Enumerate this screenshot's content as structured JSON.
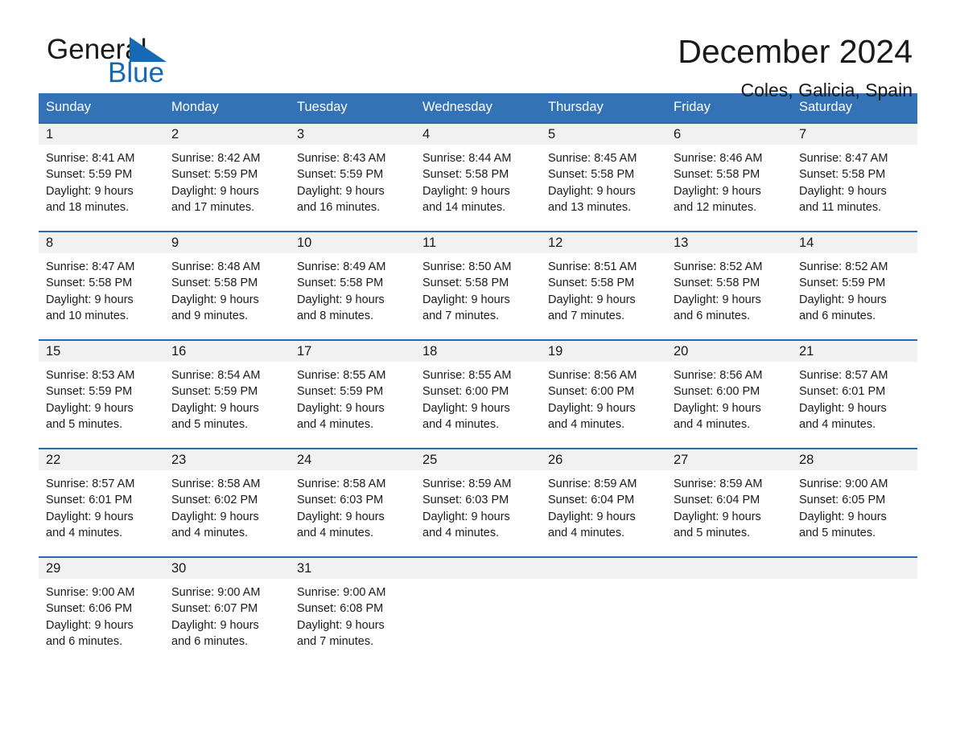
{
  "brand": {
    "name_part1": "General",
    "name_part2": "Blue",
    "accent_color": "#1669b2",
    "logo_icon": "triangle-flag-icon"
  },
  "header": {
    "title": "December 2024",
    "location": "Coles, Galicia, Spain"
  },
  "calendar": {
    "header_bg": "#3272b5",
    "row_divider_color": "#2a6ab0",
    "day_band_bg": "#f1f1f1",
    "weekday_headers": [
      "Sunday",
      "Monday",
      "Tuesday",
      "Wednesday",
      "Thursday",
      "Friday",
      "Saturday"
    ],
    "weeks": [
      [
        {
          "day": "1",
          "sunrise": "Sunrise: 8:41 AM",
          "sunset": "Sunset: 5:59 PM",
          "daylight_1": "Daylight: 9 hours",
          "daylight_2": "and 18 minutes."
        },
        {
          "day": "2",
          "sunrise": "Sunrise: 8:42 AM",
          "sunset": "Sunset: 5:59 PM",
          "daylight_1": "Daylight: 9 hours",
          "daylight_2": "and 17 minutes."
        },
        {
          "day": "3",
          "sunrise": "Sunrise: 8:43 AM",
          "sunset": "Sunset: 5:59 PM",
          "daylight_1": "Daylight: 9 hours",
          "daylight_2": "and 16 minutes."
        },
        {
          "day": "4",
          "sunrise": "Sunrise: 8:44 AM",
          "sunset": "Sunset: 5:58 PM",
          "daylight_1": "Daylight: 9 hours",
          "daylight_2": "and 14 minutes."
        },
        {
          "day": "5",
          "sunrise": "Sunrise: 8:45 AM",
          "sunset": "Sunset: 5:58 PM",
          "daylight_1": "Daylight: 9 hours",
          "daylight_2": "and 13 minutes."
        },
        {
          "day": "6",
          "sunrise": "Sunrise: 8:46 AM",
          "sunset": "Sunset: 5:58 PM",
          "daylight_1": "Daylight: 9 hours",
          "daylight_2": "and 12 minutes."
        },
        {
          "day": "7",
          "sunrise": "Sunrise: 8:47 AM",
          "sunset": "Sunset: 5:58 PM",
          "daylight_1": "Daylight: 9 hours",
          "daylight_2": "and 11 minutes."
        }
      ],
      [
        {
          "day": "8",
          "sunrise": "Sunrise: 8:47 AM",
          "sunset": "Sunset: 5:58 PM",
          "daylight_1": "Daylight: 9 hours",
          "daylight_2": "and 10 minutes."
        },
        {
          "day": "9",
          "sunrise": "Sunrise: 8:48 AM",
          "sunset": "Sunset: 5:58 PM",
          "daylight_1": "Daylight: 9 hours",
          "daylight_2": "and 9 minutes."
        },
        {
          "day": "10",
          "sunrise": "Sunrise: 8:49 AM",
          "sunset": "Sunset: 5:58 PM",
          "daylight_1": "Daylight: 9 hours",
          "daylight_2": "and 8 minutes."
        },
        {
          "day": "11",
          "sunrise": "Sunrise: 8:50 AM",
          "sunset": "Sunset: 5:58 PM",
          "daylight_1": "Daylight: 9 hours",
          "daylight_2": "and 7 minutes."
        },
        {
          "day": "12",
          "sunrise": "Sunrise: 8:51 AM",
          "sunset": "Sunset: 5:58 PM",
          "daylight_1": "Daylight: 9 hours",
          "daylight_2": "and 7 minutes."
        },
        {
          "day": "13",
          "sunrise": "Sunrise: 8:52 AM",
          "sunset": "Sunset: 5:58 PM",
          "daylight_1": "Daylight: 9 hours",
          "daylight_2": "and 6 minutes."
        },
        {
          "day": "14",
          "sunrise": "Sunrise: 8:52 AM",
          "sunset": "Sunset: 5:59 PM",
          "daylight_1": "Daylight: 9 hours",
          "daylight_2": "and 6 minutes."
        }
      ],
      [
        {
          "day": "15",
          "sunrise": "Sunrise: 8:53 AM",
          "sunset": "Sunset: 5:59 PM",
          "daylight_1": "Daylight: 9 hours",
          "daylight_2": "and 5 minutes."
        },
        {
          "day": "16",
          "sunrise": "Sunrise: 8:54 AM",
          "sunset": "Sunset: 5:59 PM",
          "daylight_1": "Daylight: 9 hours",
          "daylight_2": "and 5 minutes."
        },
        {
          "day": "17",
          "sunrise": "Sunrise: 8:55 AM",
          "sunset": "Sunset: 5:59 PM",
          "daylight_1": "Daylight: 9 hours",
          "daylight_2": "and 4 minutes."
        },
        {
          "day": "18",
          "sunrise": "Sunrise: 8:55 AM",
          "sunset": "Sunset: 6:00 PM",
          "daylight_1": "Daylight: 9 hours",
          "daylight_2": "and 4 minutes."
        },
        {
          "day": "19",
          "sunrise": "Sunrise: 8:56 AM",
          "sunset": "Sunset: 6:00 PM",
          "daylight_1": "Daylight: 9 hours",
          "daylight_2": "and 4 minutes."
        },
        {
          "day": "20",
          "sunrise": "Sunrise: 8:56 AM",
          "sunset": "Sunset: 6:00 PM",
          "daylight_1": "Daylight: 9 hours",
          "daylight_2": "and 4 minutes."
        },
        {
          "day": "21",
          "sunrise": "Sunrise: 8:57 AM",
          "sunset": "Sunset: 6:01 PM",
          "daylight_1": "Daylight: 9 hours",
          "daylight_2": "and 4 minutes."
        }
      ],
      [
        {
          "day": "22",
          "sunrise": "Sunrise: 8:57 AM",
          "sunset": "Sunset: 6:01 PM",
          "daylight_1": "Daylight: 9 hours",
          "daylight_2": "and 4 minutes."
        },
        {
          "day": "23",
          "sunrise": "Sunrise: 8:58 AM",
          "sunset": "Sunset: 6:02 PM",
          "daylight_1": "Daylight: 9 hours",
          "daylight_2": "and 4 minutes."
        },
        {
          "day": "24",
          "sunrise": "Sunrise: 8:58 AM",
          "sunset": "Sunset: 6:03 PM",
          "daylight_1": "Daylight: 9 hours",
          "daylight_2": "and 4 minutes."
        },
        {
          "day": "25",
          "sunrise": "Sunrise: 8:59 AM",
          "sunset": "Sunset: 6:03 PM",
          "daylight_1": "Daylight: 9 hours",
          "daylight_2": "and 4 minutes."
        },
        {
          "day": "26",
          "sunrise": "Sunrise: 8:59 AM",
          "sunset": "Sunset: 6:04 PM",
          "daylight_1": "Daylight: 9 hours",
          "daylight_2": "and 4 minutes."
        },
        {
          "day": "27",
          "sunrise": "Sunrise: 8:59 AM",
          "sunset": "Sunset: 6:04 PM",
          "daylight_1": "Daylight: 9 hours",
          "daylight_2": "and 5 minutes."
        },
        {
          "day": "28",
          "sunrise": "Sunrise: 9:00 AM",
          "sunset": "Sunset: 6:05 PM",
          "daylight_1": "Daylight: 9 hours",
          "daylight_2": "and 5 minutes."
        }
      ],
      [
        {
          "day": "29",
          "sunrise": "Sunrise: 9:00 AM",
          "sunset": "Sunset: 6:06 PM",
          "daylight_1": "Daylight: 9 hours",
          "daylight_2": "and 6 minutes."
        },
        {
          "day": "30",
          "sunrise": "Sunrise: 9:00 AM",
          "sunset": "Sunset: 6:07 PM",
          "daylight_1": "Daylight: 9 hours",
          "daylight_2": "and 6 minutes."
        },
        {
          "day": "31",
          "sunrise": "Sunrise: 9:00 AM",
          "sunset": "Sunset: 6:08 PM",
          "daylight_1": "Daylight: 9 hours",
          "daylight_2": "and 7 minutes."
        },
        {
          "day": "",
          "sunrise": "",
          "sunset": "",
          "daylight_1": "",
          "daylight_2": ""
        },
        {
          "day": "",
          "sunrise": "",
          "sunset": "",
          "daylight_1": "",
          "daylight_2": ""
        },
        {
          "day": "",
          "sunrise": "",
          "sunset": "",
          "daylight_1": "",
          "daylight_2": ""
        },
        {
          "day": "",
          "sunrise": "",
          "sunset": "",
          "daylight_1": "",
          "daylight_2": ""
        }
      ]
    ]
  }
}
